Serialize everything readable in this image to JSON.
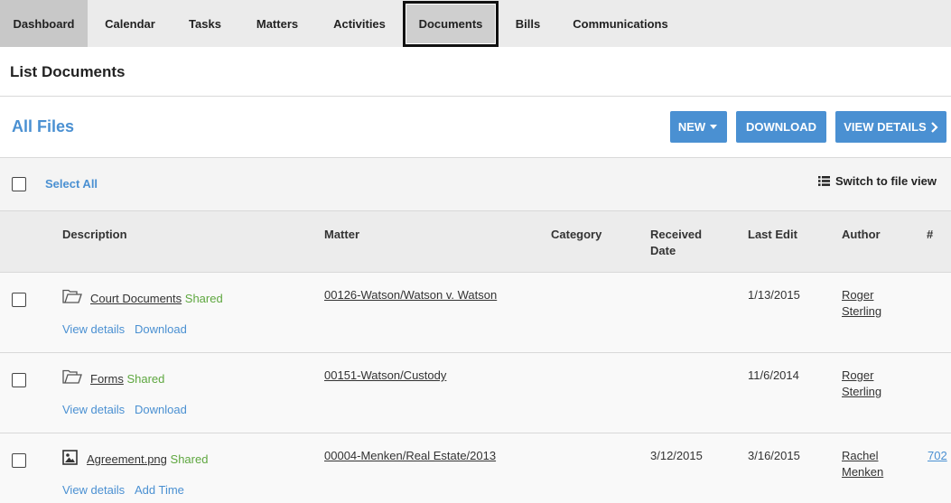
{
  "nav": {
    "tabs": [
      "Dashboard",
      "Calendar",
      "Tasks",
      "Matters",
      "Activities",
      "Documents",
      "Bills",
      "Communications"
    ]
  },
  "page": {
    "title": "List Documents"
  },
  "files": {
    "heading": "All Files"
  },
  "toolbar": {
    "new_label": "NEW",
    "download_label": "DOWNLOAD",
    "view_details_label": "VIEW DETAILS"
  },
  "selection": {
    "select_all": "Select All",
    "switch_view": "Switch to file view"
  },
  "table": {
    "headers": {
      "description": "Description",
      "matter": "Matter",
      "category": "Category",
      "received_1": "Received",
      "received_2": "Date",
      "last_edit": "Last Edit",
      "author": "Author",
      "count": "#"
    },
    "rows": [
      {
        "name": "Court Documents",
        "shared": "Shared",
        "matter": "00126-Watson/Watson v. Watson",
        "received": "",
        "last_edit": "1/13/2015",
        "author_1": "Roger",
        "author_2": "Sterling",
        "count": "",
        "action_1": "View details",
        "action_2": "Download",
        "icon": "folder-icon"
      },
      {
        "name": "Forms",
        "shared": "Shared",
        "matter": "00151-Watson/Custody",
        "received": "",
        "last_edit": "11/6/2014",
        "author_1": "Roger",
        "author_2": "Sterling",
        "count": "",
        "action_1": "View details",
        "action_2": "Download",
        "icon": "folder-icon"
      },
      {
        "name": "Agreement.png",
        "shared": "Shared",
        "matter": "00004-Menken/Real Estate/2013",
        "received": "3/12/2015",
        "last_edit": "3/16/2015",
        "author_1": "Rachel",
        "author_2": "Menken",
        "count": "702",
        "action_1": "View details",
        "action_2": "Add Time",
        "icon": "image-file-icon"
      }
    ]
  },
  "colors": {
    "accent": "#4a90d2",
    "shared": "#5ea73f"
  }
}
